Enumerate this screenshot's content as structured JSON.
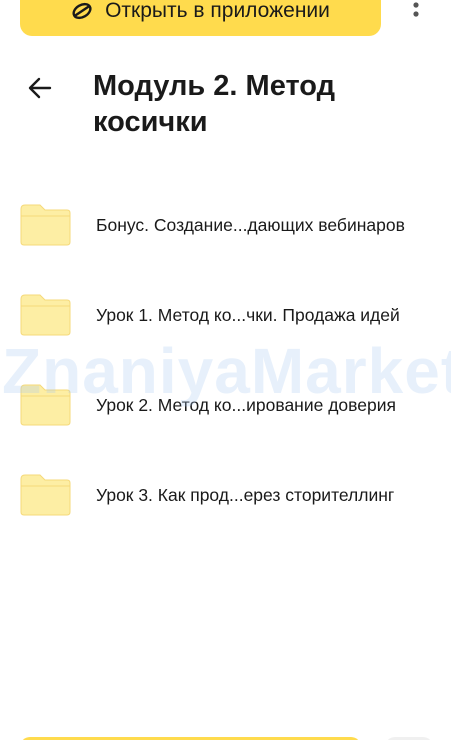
{
  "top_bar": {
    "open_app_label": "Открыть в приложении",
    "open_app_icon": "disk-icon",
    "more_icon": "more-vertical-icon"
  },
  "header": {
    "back_icon": "arrow-left-icon",
    "title": "Модуль 2. Метод косички"
  },
  "folders": [
    {
      "name": "Бонус. Создание...дающих вебинаров",
      "icon": "folder-icon"
    },
    {
      "name": "Урок 1. Метод ко...чки. Продажа идей",
      "icon": "folder-icon"
    },
    {
      "name": "Урок 2. Метод ко...ирование доверия",
      "icon": "folder-icon"
    },
    {
      "name": "Урок 3. Как прод...ерез сторителлинг",
      "icon": "folder-icon"
    }
  ],
  "watermark": "ZnaniyaMarket.ru",
  "colors": {
    "accent_yellow": "#ffdb4d",
    "folder_fill": "#fdeea4",
    "folder_stroke": "#f5d97a",
    "text": "#1a1a1a"
  }
}
